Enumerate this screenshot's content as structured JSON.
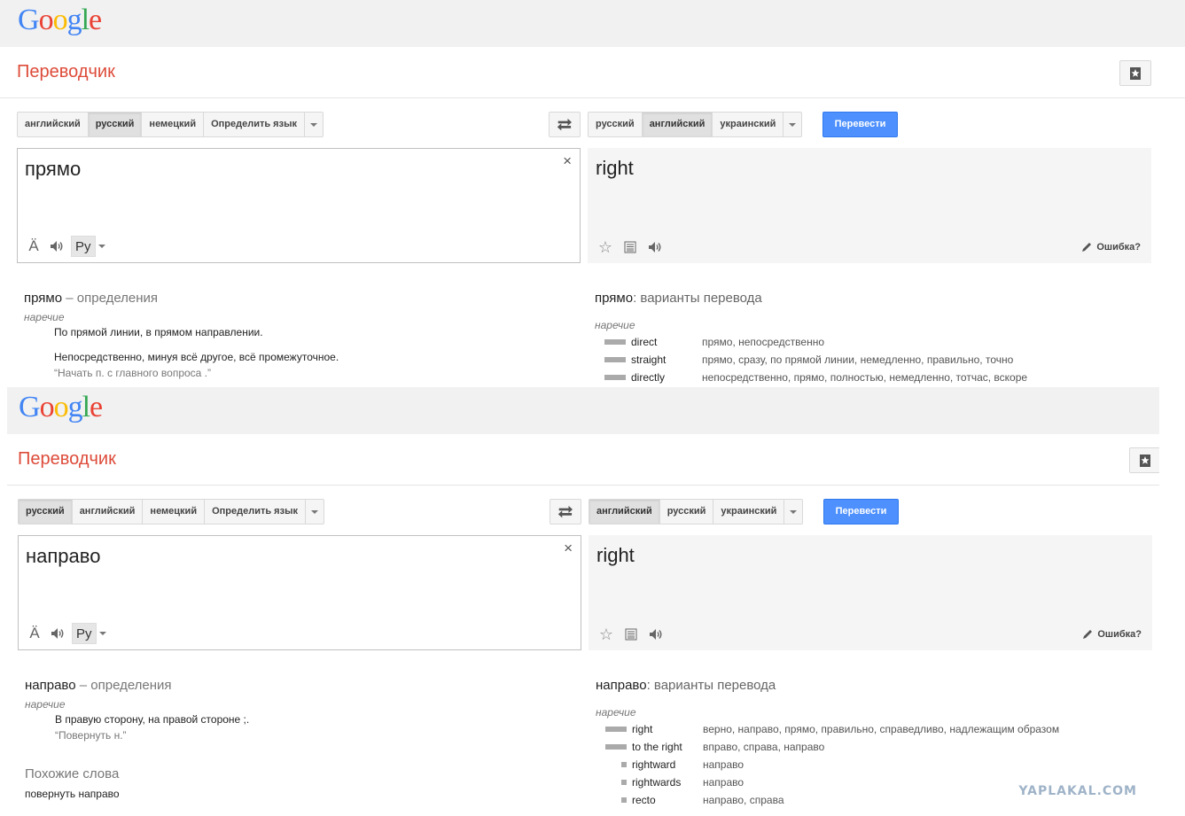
{
  "panels": [
    {
      "logo": {
        "text": "Google",
        "colors": [
          "#4285f4",
          "#ea4335",
          "#fbbc05",
          "#4285f4",
          "#34a853",
          "#ea4335"
        ]
      },
      "app_title": "Переводчик",
      "source_langs": [
        "английский",
        "русский",
        "немецкий",
        "Определить язык"
      ],
      "source_active": 1,
      "target_langs": [
        "русский",
        "английский",
        "украинский"
      ],
      "target_active": 1,
      "translate_label": "Перевести",
      "source_text": "прямо",
      "target_text": "right",
      "clear_icon": "×",
      "ime_label": "Ру",
      "wrong_label": "Ошибка?",
      "definitions": {
        "word": "прямо",
        "suffix": "– определения",
        "pos": "наречие",
        "items": [
          {
            "text": "По прямой линии, в прямом направлении.",
            "example": ""
          },
          {
            "text": "Непосредственно, минуя всё другое, всё промежуточное.",
            "example": "“Начать п. с главного вопроса .”"
          }
        ]
      },
      "alternatives": {
        "word": "прямо",
        "suffix": ": варианты перевода",
        "pos": "наречие",
        "rows": [
          {
            "word": "direct",
            "translations": "прямо, непосредственно",
            "freq": 1.0
          },
          {
            "word": "straight",
            "translations": "прямо, сразу, по прямой линии, немедленно, правильно, точно",
            "freq": 1.0
          },
          {
            "word": "directly",
            "translations": "непосредственно, прямо, полностью, немедленно, тотчас, вскоре",
            "freq": 1.0
          }
        ]
      }
    },
    {
      "logo": {
        "text": "Google",
        "colors": [
          "#4285f4",
          "#ea4335",
          "#fbbc05",
          "#4285f4",
          "#34a853",
          "#ea4335"
        ]
      },
      "app_title": "Переводчик",
      "source_langs": [
        "русский",
        "английский",
        "немецкий",
        "Определить язык"
      ],
      "source_active": 0,
      "target_langs": [
        "английский",
        "русский",
        "украинский"
      ],
      "target_active": 0,
      "translate_label": "Перевести",
      "source_text": "направо",
      "target_text": "right",
      "clear_icon": "×",
      "ime_label": "Ру",
      "wrong_label": "Ошибка?",
      "definitions": {
        "word": "направо",
        "suffix": "– определения",
        "pos": "наречие",
        "items": [
          {
            "text": "В правую сторону, на правой стороне ;.",
            "example": "“Повернуть н.”"
          }
        ]
      },
      "similar": {
        "title": "Похожие слова",
        "items": [
          "повернуть направо"
        ]
      },
      "alternatives": {
        "word": "направо",
        "suffix": ": варианты перевода",
        "pos": "наречие",
        "rows": [
          {
            "word": "right",
            "translations": "верно, направо, прямо, правильно, справедливо, надлежащим образом",
            "freq": 1.0
          },
          {
            "word": "to the right",
            "translations": "вправо, справа, направо",
            "freq": 1.0
          },
          {
            "word": "rightward",
            "translations": "направо",
            "freq": 0.25
          },
          {
            "word": "rightwards",
            "translations": "направо",
            "freq": 0.25
          },
          {
            "word": "recto",
            "translations": "направо, справа",
            "freq": 0.25
          }
        ]
      }
    }
  ],
  "watermark": "YAPLAKAL.COM"
}
